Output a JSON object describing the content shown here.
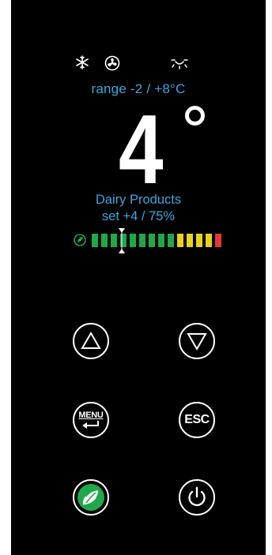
{
  "status_icons": [
    "snowflake-icon",
    "fan-icon",
    "light-icon"
  ],
  "display": {
    "range": "range -2 / +8°C",
    "temperature": "4",
    "product": "Dairy Products",
    "setpoint": "set +4 / 75%"
  },
  "level_bar": {
    "segments": 14,
    "colors": {
      "green": "#1fa84a",
      "yellow": "#e8d21a",
      "red": "#e23a32",
      "leaf": "#1fa84a"
    },
    "pattern": [
      "green",
      "green",
      "green",
      "green",
      "green",
      "green",
      "green",
      "green",
      "green",
      "yellow",
      "yellow",
      "yellow",
      "yellow",
      "red"
    ]
  },
  "buttons": {
    "menu_label": "MENU",
    "esc_label": "ESC"
  },
  "colors": {
    "text_accent": "#3aa7df",
    "background": "#000000"
  }
}
